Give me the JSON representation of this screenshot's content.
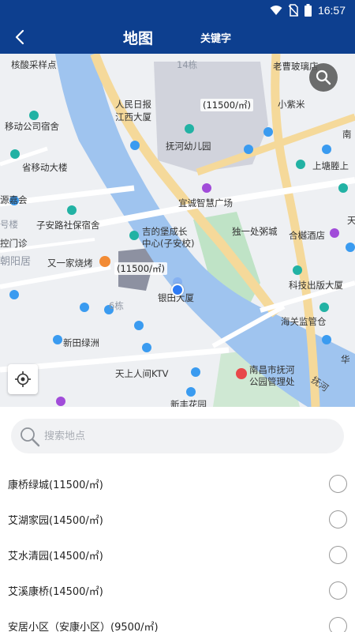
{
  "status_bar": {
    "time": "16:57",
    "icons": [
      "wifi-icon",
      "no-sim-icon",
      "battery-icon"
    ]
  },
  "header": {
    "title": "地图",
    "keyword_label": "关键字",
    "back_icon": "chevron-left-icon"
  },
  "colors": {
    "header": "#0d3f8f",
    "river": "#9fc4ef",
    "major_road": "#f5d99a",
    "park": "#bfe3c6",
    "marker": "#2e7bf5"
  },
  "map": {
    "labels": [
      "核酸采样点",
      "人民日报",
      "江西大厦",
      "移动公司宿舍",
      "抚河幼儿园",
      "小紫米",
      "省移动大楼",
      "上塘塍上",
      "源嘉会",
      "宜诚智慧广场",
      "子安路社保宿舍",
      "吉的堡成长",
      "中心(子安校)",
      "独一处粥城",
      "合樾酒店",
      "又一家烧烤",
      "科技出版大厦",
      "银田大厦",
      "新田绿洲",
      "海关监管仓",
      "天上人间KTV",
      "南昌市抚河",
      "公园管理处",
      "老曹玻璃店",
      "南",
      "天",
      "华",
      "新丰花园",
      "14栋",
      "6栋",
      "抚河",
      "朝阳居",
      "控门诊",
      "号楼"
    ],
    "price_tags": [
      "(11500/㎡)",
      "(11500/㎡)"
    ]
  },
  "search": {
    "placeholder": "搜索地点",
    "value": ""
  },
  "list": [
    {
      "label": "康桥绿城(11500/㎡)",
      "selected": false
    },
    {
      "label": "艾湖家园(14500/㎡)",
      "selected": false
    },
    {
      "label": "艾水清园(14500/㎡)",
      "selected": false
    },
    {
      "label": "艾溪康桥(14500/㎡)",
      "selected": false
    },
    {
      "label": "安居小区（安康小区）(9500/㎡)",
      "selected": false
    }
  ]
}
